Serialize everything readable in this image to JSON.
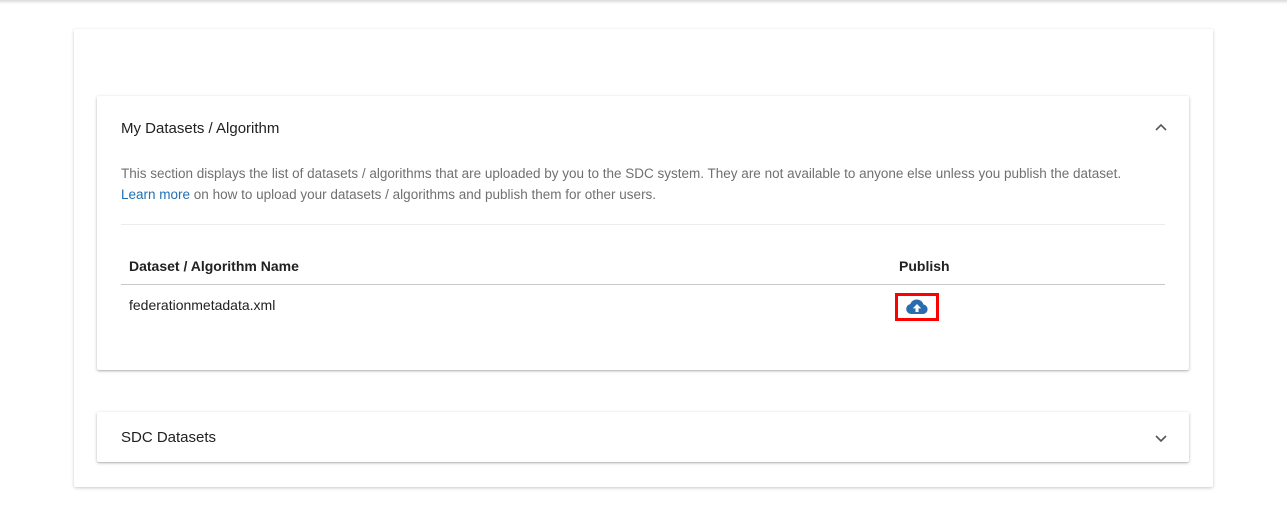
{
  "my_datasets": {
    "title": "My Datasets / Algorithm",
    "description": "This section displays the list of datasets / algorithms that are uploaded by you to the SDC system. They are not available to anyone else unless you publish the dataset.",
    "learn_more_link": "Learn more",
    "learn_more_suffix": " on how to upload your datasets / algorithms and publish them for other users.",
    "expanded": true,
    "table": {
      "columns": [
        "Dataset / Algorithm Name",
        "Publish"
      ],
      "rows": [
        {
          "name": "federationmetadata.xml",
          "publish_icon": "cloud-upload-icon"
        }
      ]
    }
  },
  "sdc_datasets": {
    "title": "SDC Datasets",
    "expanded": false
  },
  "colors": {
    "link": "#1f6fb5",
    "publish_icon": "#2b6cb0",
    "highlight_border": "#ff0000"
  }
}
